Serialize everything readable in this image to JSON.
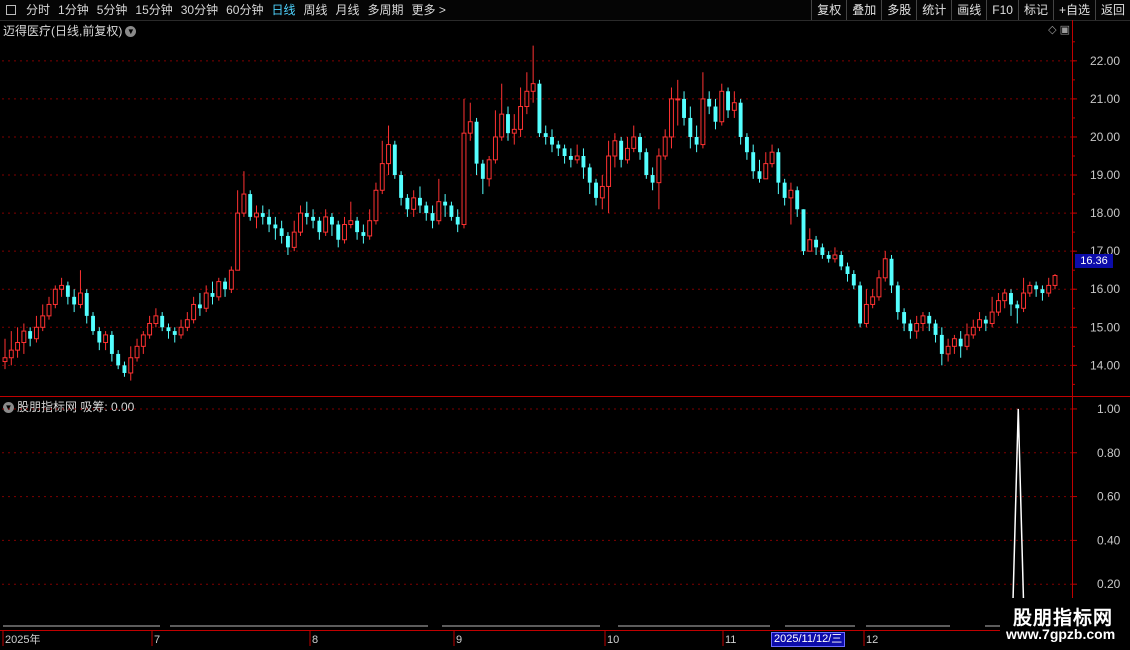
{
  "toolbar": {
    "periods": [
      "分时",
      "1分钟",
      "5分钟",
      "15分钟",
      "30分钟",
      "60分钟",
      "日线",
      "周线",
      "月线",
      "多周期",
      "更多 >"
    ],
    "active_period": "日线",
    "right_buttons": [
      "复权",
      "叠加",
      "多股",
      "统计",
      "画线",
      "F10",
      "标记",
      "+自选",
      "返回"
    ]
  },
  "main_panel": {
    "title": "迈得医疗(日线,前复权)",
    "y_ticks": [
      "22.00",
      "21.00",
      "20.00",
      "19.00",
      "18.00",
      "17.00",
      "16.00",
      "15.00",
      "14.00"
    ],
    "current_price_label": "16.36"
  },
  "indicator_panel": {
    "title": "股朋指标网  吸筹: 0.00",
    "y_ticks": [
      "1.00",
      "0.80",
      "0.60",
      "0.40",
      "0.20"
    ]
  },
  "x_axis": {
    "labels": [
      "2025年",
      "7",
      "8",
      "9",
      "10",
      "11",
      "12"
    ],
    "cursor_date": "2025/11/12/三"
  },
  "watermark": {
    "line1": "股朋指标网",
    "line2": "www.7gpzb.com"
  },
  "colors": {
    "up": "#ff3232",
    "down": "#54ffff",
    "grid": "#800000",
    "axis": "#c00000",
    "signal": "#ffffff",
    "highlight": "#0c0caa"
  },
  "chart_data": [
    {
      "type": "candlestick",
      "title": "迈得医疗(日线,前复权)",
      "ylim": [
        13.3,
        22.6
      ],
      "series": [
        {
          "values": [
            [
              14.1,
              14.2,
              14.7,
              13.9
            ],
            [
              14.2,
              14.4,
              14.9,
              14.0
            ],
            [
              14.4,
              14.6,
              15.0,
              14.2
            ],
            [
              14.6,
              14.9,
              15.1,
              14.3
            ],
            [
              14.9,
              14.7,
              15.0,
              14.5
            ],
            [
              14.7,
              15.0,
              15.3,
              14.6
            ],
            [
              15.0,
              15.3,
              15.6,
              14.9
            ],
            [
              15.3,
              15.6,
              15.8,
              15.2
            ],
            [
              15.6,
              16.0,
              16.1,
              15.5
            ],
            [
              16.0,
              16.1,
              16.3,
              15.8
            ],
            [
              16.1,
              15.8,
              16.2,
              15.6
            ],
            [
              15.8,
              15.6,
              16.0,
              15.4
            ],
            [
              15.6,
              15.9,
              16.5,
              15.5
            ],
            [
              15.9,
              15.3,
              16.0,
              15.1
            ],
            [
              15.3,
              14.9,
              15.4,
              14.8
            ],
            [
              14.9,
              14.6,
              15.0,
              14.4
            ],
            [
              14.6,
              14.8,
              14.9,
              14.4
            ],
            [
              14.8,
              14.3,
              14.9,
              14.1
            ],
            [
              14.3,
              14.0,
              14.4,
              13.9
            ],
            [
              14.0,
              13.8,
              14.1,
              13.7
            ],
            [
              13.8,
              14.2,
              14.5,
              13.6
            ],
            [
              14.2,
              14.5,
              14.7,
              14.1
            ],
            [
              14.5,
              14.8,
              14.9,
              14.3
            ],
            [
              14.8,
              15.1,
              15.3,
              14.7
            ],
            [
              15.1,
              15.3,
              15.5,
              15.0
            ],
            [
              15.3,
              15.0,
              15.4,
              14.9
            ],
            [
              15.0,
              14.9,
              15.1,
              14.7
            ],
            [
              14.9,
              14.8,
              15.0,
              14.6
            ],
            [
              14.8,
              15.0,
              15.2,
              14.7
            ],
            [
              15.0,
              15.2,
              15.4,
              14.9
            ],
            [
              15.2,
              15.6,
              15.8,
              15.1
            ],
            [
              15.6,
              15.5,
              15.9,
              15.3
            ],
            [
              15.5,
              15.9,
              16.1,
              15.4
            ],
            [
              15.9,
              15.8,
              16.2,
              15.6
            ],
            [
              15.8,
              16.2,
              16.3,
              15.7
            ],
            [
              16.2,
              16.0,
              16.3,
              15.8
            ],
            [
              16.0,
              16.5,
              16.6,
              15.9
            ],
            [
              16.5,
              18.0,
              18.6,
              16.5
            ],
            [
              18.0,
              18.5,
              19.1,
              17.9
            ],
            [
              18.5,
              17.9,
              18.6,
              17.8
            ],
            [
              17.9,
              18.0,
              18.2,
              17.6
            ],
            [
              18.0,
              17.9,
              18.2,
              17.7
            ],
            [
              17.9,
              17.7,
              18.1,
              17.5
            ],
            [
              17.7,
              17.6,
              17.9,
              17.3
            ],
            [
              17.6,
              17.4,
              17.8,
              17.2
            ],
            [
              17.4,
              17.1,
              17.5,
              16.9
            ],
            [
              17.1,
              17.5,
              17.8,
              17.0
            ],
            [
              17.5,
              18.0,
              18.2,
              17.4
            ],
            [
              18.0,
              17.9,
              18.3,
              17.7
            ],
            [
              17.9,
              17.8,
              18.1,
              17.6
            ],
            [
              17.8,
              17.5,
              17.9,
              17.3
            ],
            [
              17.5,
              17.9,
              18.1,
              17.4
            ],
            [
              17.9,
              17.7,
              18.0,
              17.4
            ],
            [
              17.7,
              17.3,
              17.8,
              17.1
            ],
            [
              17.3,
              17.7,
              17.9,
              17.2
            ],
            [
              17.7,
              17.8,
              18.3,
              17.6
            ],
            [
              17.8,
              17.5,
              17.9,
              17.3
            ],
            [
              17.5,
              17.4,
              17.7,
              17.2
            ],
            [
              17.4,
              17.8,
              18.1,
              17.3
            ],
            [
              17.8,
              18.6,
              18.8,
              17.7
            ],
            [
              18.6,
              19.3,
              19.9,
              18.5
            ],
            [
              19.3,
              19.8,
              20.3,
              19.0
            ],
            [
              19.8,
              19.0,
              19.9,
              18.9
            ],
            [
              19.0,
              18.4,
              19.1,
              18.2
            ],
            [
              18.4,
              18.1,
              18.5,
              17.9
            ],
            [
              18.1,
              18.4,
              18.6,
              17.9
            ],
            [
              18.4,
              18.2,
              18.7,
              18.0
            ],
            [
              18.2,
              18.0,
              18.3,
              17.8
            ],
            [
              18.0,
              17.8,
              18.2,
              17.6
            ],
            [
              17.8,
              18.3,
              18.9,
              17.7
            ],
            [
              18.3,
              18.2,
              18.5,
              17.9
            ],
            [
              18.2,
              17.9,
              18.3,
              17.8
            ],
            [
              17.9,
              17.7,
              18.1,
              17.5
            ],
            [
              17.7,
              20.1,
              21.0,
              17.6
            ],
            [
              20.1,
              20.4,
              20.9,
              19.9
            ],
            [
              20.4,
              19.3,
              20.5,
              19.0
            ],
            [
              19.3,
              18.9,
              19.4,
              18.5
            ],
            [
              18.9,
              19.4,
              19.5,
              18.7
            ],
            [
              19.4,
              20.0,
              20.7,
              19.3
            ],
            [
              20.0,
              20.6,
              21.4,
              19.9
            ],
            [
              20.6,
              20.1,
              20.8,
              19.9
            ],
            [
              20.1,
              20.2,
              20.6,
              19.8
            ],
            [
              20.2,
              20.8,
              21.3,
              20.0
            ],
            [
              20.8,
              21.2,
              21.7,
              20.6
            ],
            [
              21.2,
              21.4,
              22.4,
              20.9
            ],
            [
              21.4,
              20.1,
              21.5,
              20.0
            ],
            [
              20.1,
              20.0,
              20.3,
              19.8
            ],
            [
              20.0,
              19.8,
              20.2,
              19.6
            ],
            [
              19.8,
              19.7,
              19.9,
              19.5
            ],
            [
              19.7,
              19.5,
              19.8,
              19.3
            ],
            [
              19.5,
              19.4,
              19.7,
              19.2
            ],
            [
              19.4,
              19.5,
              19.8,
              19.3
            ],
            [
              19.5,
              19.2,
              19.7,
              18.9
            ],
            [
              19.2,
              18.8,
              19.3,
              18.5
            ],
            [
              18.8,
              18.4,
              18.9,
              18.2
            ],
            [
              18.4,
              18.7,
              19.0,
              18.1
            ],
            [
              18.7,
              19.5,
              19.9,
              18.0
            ],
            [
              19.5,
              19.9,
              20.1,
              19.2
            ],
            [
              19.9,
              19.4,
              20.0,
              19.2
            ],
            [
              19.4,
              19.7,
              20.0,
              19.3
            ],
            [
              19.7,
              20.0,
              20.3,
              19.6
            ],
            [
              20.0,
              19.6,
              20.1,
              19.4
            ],
            [
              19.6,
              19.0,
              19.7,
              18.9
            ],
            [
              19.0,
              18.8,
              19.2,
              18.6
            ],
            [
              18.8,
              19.5,
              19.7,
              18.1
            ],
            [
              19.5,
              20.0,
              20.2,
              19.4
            ],
            [
              20.0,
              21.0,
              21.3,
              19.7
            ],
            [
              21.0,
              21.0,
              21.5,
              20.3
            ],
            [
              21.0,
              20.5,
              21.2,
              20.3
            ],
            [
              20.5,
              20.0,
              20.8,
              19.7
            ],
            [
              20.0,
              19.8,
              20.3,
              19.6
            ],
            [
              19.8,
              21.0,
              21.7,
              19.7
            ],
            [
              21.0,
              20.8,
              21.2,
              20.6
            ],
            [
              20.8,
              20.4,
              21.0,
              20.2
            ],
            [
              20.4,
              21.2,
              21.4,
              20.3
            ],
            [
              21.2,
              20.7,
              21.3,
              20.5
            ],
            [
              20.7,
              20.9,
              21.2,
              20.5
            ],
            [
              20.9,
              20.0,
              21.0,
              19.8
            ],
            [
              20.0,
              19.6,
              20.1,
              19.4
            ],
            [
              19.6,
              19.1,
              19.8,
              18.9
            ],
            [
              19.1,
              18.9,
              19.4,
              18.8
            ],
            [
              18.9,
              19.3,
              19.6,
              18.9
            ],
            [
              19.3,
              19.6,
              19.8,
              19.2
            ],
            [
              19.6,
              18.8,
              19.7,
              18.5
            ],
            [
              18.8,
              18.4,
              18.9,
              18.2
            ],
            [
              18.4,
              18.6,
              18.8,
              17.7
            ],
            [
              18.6,
              18.1,
              18.7,
              17.9
            ],
            [
              18.1,
              17.0,
              18.1,
              16.9
            ],
            [
              17.0,
              17.3,
              17.6,
              17.0
            ],
            [
              17.3,
              17.1,
              17.4,
              16.9
            ],
            [
              17.1,
              16.9,
              17.2,
              16.8
            ],
            [
              16.9,
              16.8,
              17.0,
              16.7
            ],
            [
              16.8,
              16.9,
              17.1,
              16.7
            ],
            [
              16.9,
              16.6,
              17.0,
              16.5
            ],
            [
              16.6,
              16.4,
              16.7,
              16.2
            ],
            [
              16.4,
              16.1,
              16.5,
              16.0
            ],
            [
              16.1,
              15.1,
              16.2,
              15.0
            ],
            [
              15.1,
              15.6,
              16.0,
              15.0
            ],
            [
              15.6,
              15.8,
              16.0,
              15.5
            ],
            [
              15.8,
              16.3,
              16.5,
              15.7
            ],
            [
              16.3,
              16.8,
              17.0,
              16.2
            ],
            [
              16.8,
              16.1,
              16.9,
              15.9
            ],
            [
              16.1,
              15.4,
              16.2,
              15.2
            ],
            [
              15.4,
              15.1,
              15.5,
              14.9
            ],
            [
              15.1,
              14.9,
              15.2,
              14.7
            ],
            [
              14.9,
              15.1,
              15.3,
              14.7
            ],
            [
              15.1,
              15.3,
              15.4,
              14.9
            ],
            [
              15.3,
              15.1,
              15.4,
              14.9
            ],
            [
              15.1,
              14.8,
              15.2,
              14.6
            ],
            [
              14.8,
              14.3,
              15.0,
              14.0
            ],
            [
              14.3,
              14.5,
              14.7,
              14.1
            ],
            [
              14.5,
              14.7,
              14.8,
              14.3
            ],
            [
              14.7,
              14.5,
              14.9,
              14.2
            ],
            [
              14.5,
              14.8,
              15.1,
              14.4
            ],
            [
              14.8,
              15.0,
              15.2,
              14.7
            ],
            [
              15.0,
              15.2,
              15.4,
              14.9
            ],
            [
              15.2,
              15.1,
              15.3,
              14.9
            ],
            [
              15.1,
              15.4,
              15.8,
              15.0
            ],
            [
              15.4,
              15.7,
              15.9,
              15.3
            ],
            [
              15.7,
              15.9,
              16.0,
              15.5
            ],
            [
              15.9,
              15.6,
              16.0,
              15.3
            ],
            [
              15.6,
              15.5,
              15.7,
              15.1
            ],
            [
              15.5,
              15.9,
              16.3,
              15.4
            ],
            [
              15.9,
              16.1,
              16.2,
              15.8
            ],
            [
              16.1,
              16.0,
              16.2,
              15.8
            ],
            [
              16.0,
              15.9,
              16.1,
              15.7
            ],
            [
              15.9,
              16.1,
              16.3,
              15.8
            ],
            [
              16.1,
              16.36,
              16.4,
              16.0
            ]
          ]
        }
      ],
      "value_format": "[open, close, high, low]"
    },
    {
      "type": "line",
      "title": "吸筹",
      "ylim": [
        0,
        1.05
      ],
      "series": [
        {
          "spike_at_fraction": 0.965,
          "spike_value": 1.0,
          "baseline": 0.0
        }
      ]
    }
  ]
}
